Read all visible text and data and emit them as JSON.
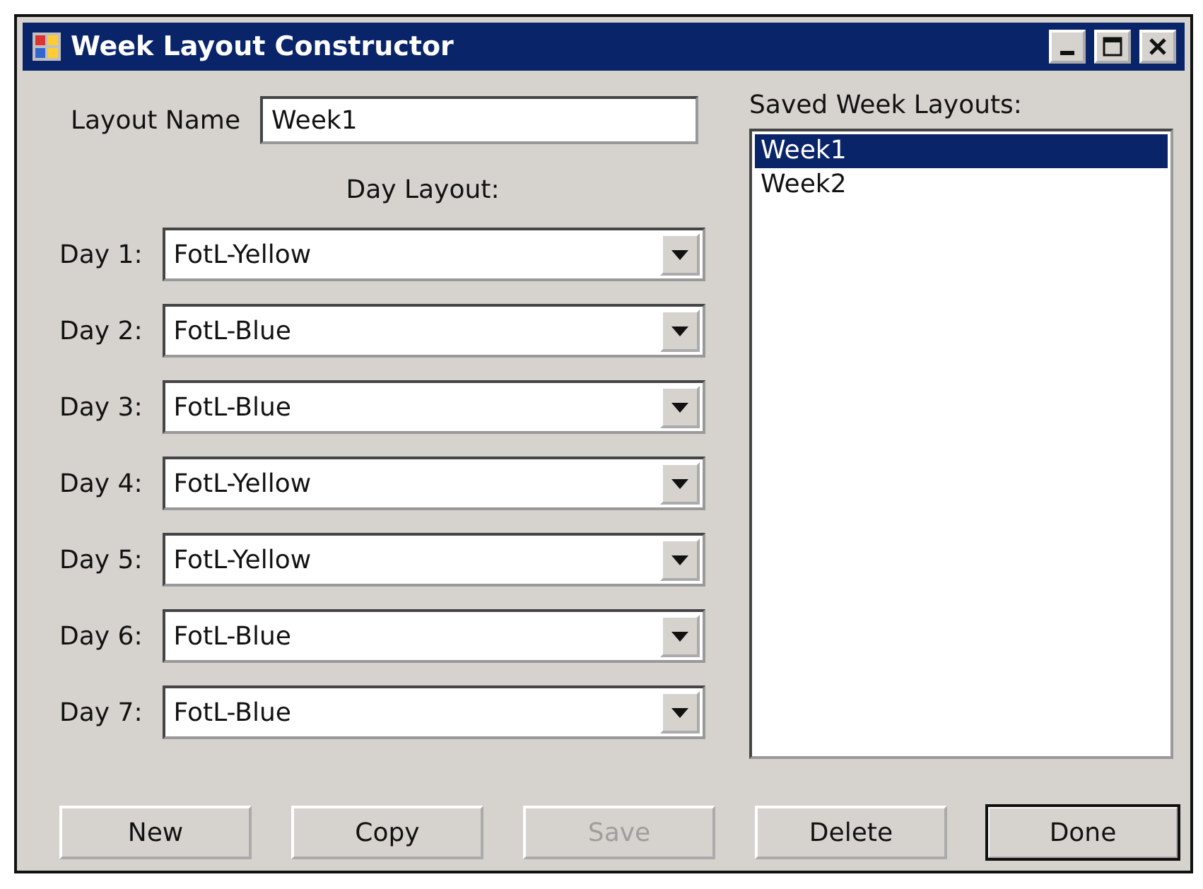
{
  "window": {
    "title": "Week Layout Constructor"
  },
  "layout_name": {
    "label": "Layout Name",
    "value": "Week1"
  },
  "day_layout": {
    "heading": "Day Layout:",
    "days": [
      {
        "label": "Day 1:",
        "value": "FotL-Yellow"
      },
      {
        "label": "Day 2:",
        "value": "FotL-Blue"
      },
      {
        "label": "Day 3:",
        "value": "FotL-Blue"
      },
      {
        "label": "Day 4:",
        "value": "FotL-Yellow"
      },
      {
        "label": "Day 5:",
        "value": "FotL-Yellow"
      },
      {
        "label": "Day 6:",
        "value": "FotL-Blue"
      },
      {
        "label": "Day 7:",
        "value": "FotL-Blue"
      }
    ]
  },
  "saved_layouts": {
    "label": "Saved Week Layouts:",
    "items": [
      {
        "label": "Week1",
        "selected": true
      },
      {
        "label": "Week2",
        "selected": false
      }
    ]
  },
  "buttons": [
    {
      "label": "New",
      "disabled": false,
      "default": false
    },
    {
      "label": "Copy",
      "disabled": false,
      "default": false
    },
    {
      "label": "Save",
      "disabled": true,
      "default": false
    },
    {
      "label": "Delete",
      "disabled": false,
      "default": false
    },
    {
      "label": "Done",
      "disabled": false,
      "default": true
    }
  ]
}
